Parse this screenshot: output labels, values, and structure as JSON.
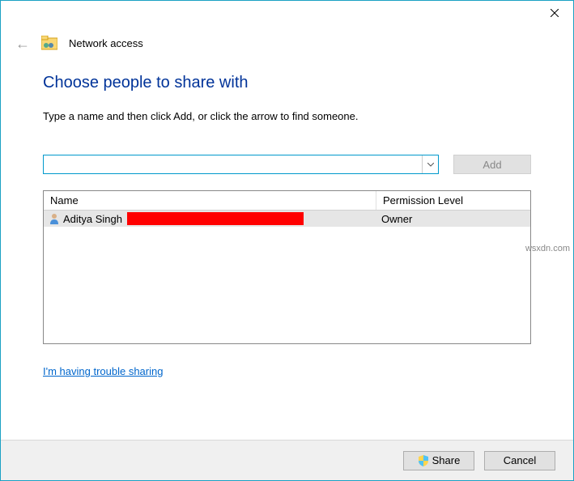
{
  "titlebar": {},
  "header": {
    "page_title": "Network access"
  },
  "main": {
    "heading": "Choose people to share with",
    "subtext": "Type a name and then click Add, or click the arrow to find someone.",
    "input_value": "",
    "add_label": "Add"
  },
  "table": {
    "columns": {
      "name": "Name",
      "permission": "Permission Level"
    },
    "rows": [
      {
        "name": "Aditya Singh",
        "permission": "Owner"
      }
    ]
  },
  "help_link": "I'm having trouble sharing",
  "footer": {
    "share_label": "Share",
    "cancel_label": "Cancel"
  },
  "watermark": "wsxdn.com"
}
